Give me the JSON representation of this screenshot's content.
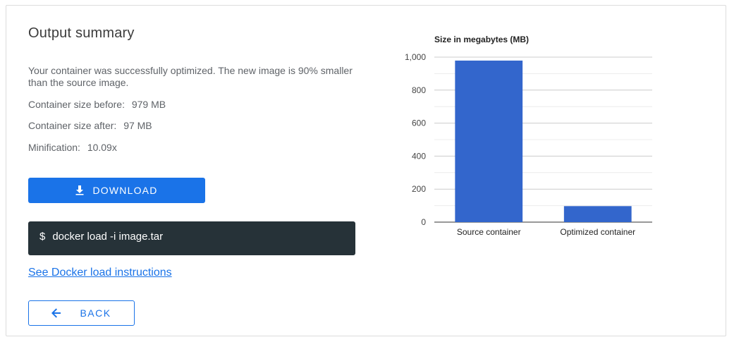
{
  "summary": {
    "title": "Output summary",
    "description": "Your container was successfully optimized. The new image is 90% smaller than the source image.",
    "size_before_label": "Container size before:",
    "size_before_value": "979 MB",
    "size_after_label": "Container size after:",
    "size_after_value": "97 MB",
    "minification_label": "Minification:",
    "minification_value": "10.09x"
  },
  "actions": {
    "download_label": "DOWNLOAD",
    "command_prompt": "$",
    "command": "docker load -i image.tar",
    "instructions_link": "See Docker load instructions",
    "back_label": "BACK"
  },
  "icons": {
    "download": "download-icon",
    "back": "arrow-left-icon"
  },
  "colors": {
    "primary": "#1a73e8",
    "bar": "#3366cc",
    "command_bg": "#263238"
  },
  "chart_data": {
    "type": "bar",
    "title": "Size in megabytes (MB)",
    "categories": [
      "Source container",
      "Optimized container"
    ],
    "values": [
      979,
      97
    ],
    "ylim": [
      0,
      1000
    ],
    "yticks": [
      "0",
      "200",
      "400",
      "600",
      "800",
      "1,000"
    ],
    "ytick_values": [
      0,
      200,
      400,
      600,
      800,
      1000
    ],
    "xlabel": "",
    "ylabel": "",
    "grid": true
  }
}
